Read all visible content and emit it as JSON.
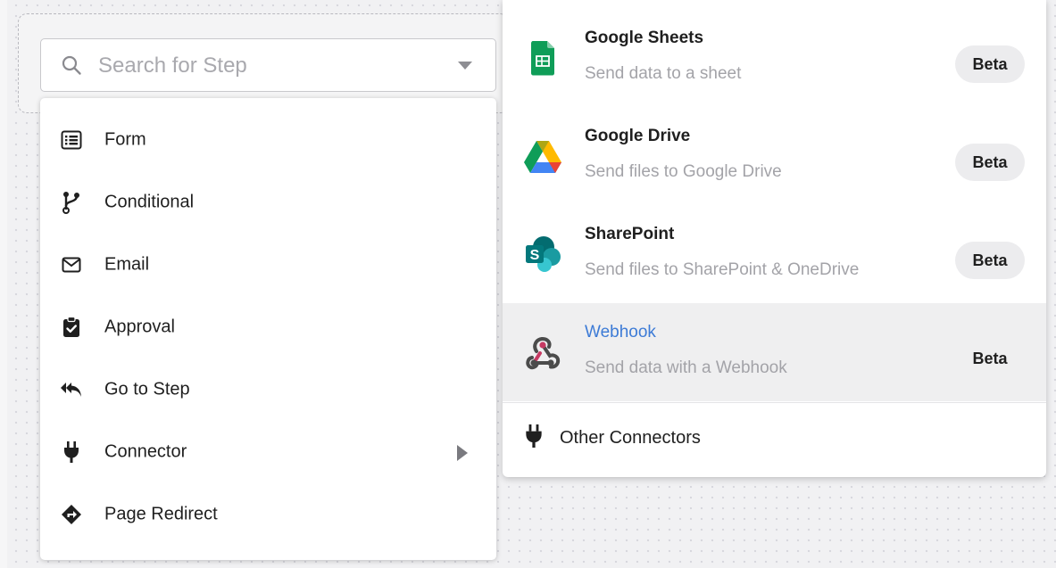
{
  "search": {
    "placeholder": "Search for Step",
    "icon": "search-icon"
  },
  "menu": {
    "items": [
      {
        "label": "Form",
        "icon": "form-icon"
      },
      {
        "label": "Conditional",
        "icon": "branch-icon"
      },
      {
        "label": "Email",
        "icon": "envelope-icon"
      },
      {
        "label": "Approval",
        "icon": "clipboard-check-icon"
      },
      {
        "label": "Go to Step",
        "icon": "reply-all-icon"
      },
      {
        "label": "Connector",
        "icon": "plug-icon",
        "has_submenu": true
      },
      {
        "label": "Page Redirect",
        "icon": "directions-icon"
      }
    ]
  },
  "connectors": {
    "items": [
      {
        "title": "Google Sheets",
        "description": "Send data to a sheet",
        "badge": "Beta",
        "icon": "google-sheets-icon"
      },
      {
        "title": "Google Drive",
        "description": "Send files to Google Drive",
        "badge": "Beta",
        "icon": "google-drive-icon"
      },
      {
        "title": "SharePoint",
        "description": "Send files to SharePoint & OneDrive",
        "badge": "Beta",
        "icon": "sharepoint-icon"
      },
      {
        "title": "Webhook",
        "description": "Send data with a Webhook",
        "badge": "Beta",
        "icon": "webhook-icon",
        "highlighted": true
      }
    ],
    "other": {
      "label": "Other Connectors",
      "icon": "plug-icon"
    }
  },
  "colors": {
    "accent": "#3d7bd6",
    "sheets_green": "#0f9d58",
    "sharepoint_teal": "#038387",
    "webhook_red": "#c73a63"
  }
}
